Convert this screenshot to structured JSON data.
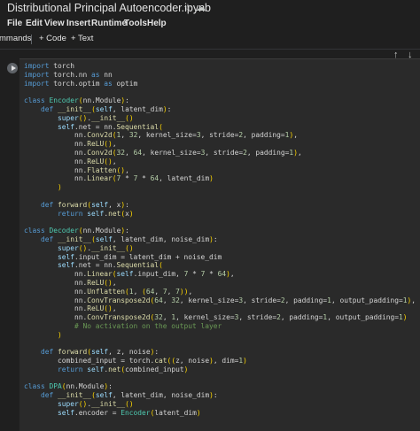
{
  "window": {
    "title": "Distributional Principal Autoencoder.ipynb"
  },
  "title_icons": [
    "star-icon",
    "cloud-icon"
  ],
  "menu": [
    "File",
    "Edit",
    "View",
    "Insert",
    "Runtime",
    "Tools",
    "Help"
  ],
  "toolbar": {
    "commands_label": "mmands",
    "add_code_label": "+ Code",
    "add_text_label": "+ Text"
  },
  "cell_toolbar": [
    "arrow-up-icon",
    "arrow-down-icon"
  ],
  "code_lines": [
    "import torch",
    "import torch.nn as nn",
    "import torch.optim as optim",
    "",
    "class Encoder(nn.Module):",
    "    def __init__(self, latent_dim):",
    "        super().__init__()",
    "        self.net = nn.Sequential(",
    "            nn.Conv2d(1, 32, kernel_size=3, stride=2, padding=1),",
    "            nn.ReLU(),",
    "            nn.Conv2d(32, 64, kernel_size=3, stride=2, padding=1),",
    "            nn.ReLU(),",
    "            nn.Flatten(),",
    "            nn.Linear(7 * 7 * 64, latent_dim)",
    "        )",
    "",
    "    def forward(self, x):",
    "        return self.net(x)",
    "",
    "class Decoder(nn.Module):",
    "    def __init__(self, latent_dim, noise_dim):",
    "        super().__init__()",
    "        self.input_dim = latent_dim + noise_dim",
    "        self.net = nn.Sequential(",
    "            nn.Linear(self.input_dim, 7 * 7 * 64),",
    "            nn.ReLU(),",
    "            nn.Unflatten(1, (64, 7, 7)),",
    "            nn.ConvTranspose2d(64, 32, kernel_size=3, stride=2, padding=1, output_padding=1),",
    "            nn.ReLU(),",
    "            nn.ConvTranspose2d(32, 1, kernel_size=3, stride=2, padding=1, output_padding=1)",
    "            # No activation on the output layer",
    "        )",
    "",
    "    def forward(self, z, noise):",
    "        combined_input = torch.cat((z, noise), dim=1)",
    "        return self.net(combined_input)",
    "",
    "class DPA(nn.Module):",
    "    def __init__(self, latent_dim, noise_dim):",
    "        super().__init__()",
    "        self.encoder = Encoder(latent_dim)"
  ]
}
